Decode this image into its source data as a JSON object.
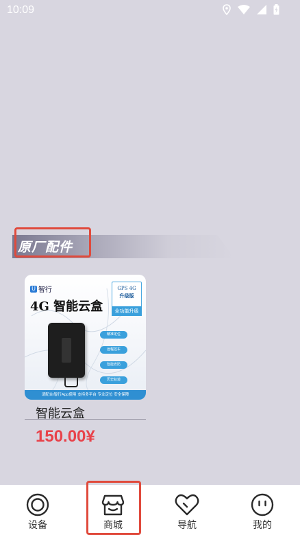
{
  "status_bar": {
    "time": "10:09",
    "icons": [
      "location-icon",
      "wifi-icon",
      "signal-icon",
      "battery-icon"
    ]
  },
  "section": {
    "title": "原厂配件"
  },
  "product": {
    "brand": "智行",
    "brand_mark": "U",
    "headline": "4G 智能云盒",
    "badge": {
      "line1": "GPS 4G",
      "line2": "升级版",
      "line3": "全功能升级"
    },
    "features": [
      "精准定位",
      "远程控车",
      "智能安防",
      "历史轨迹"
    ],
    "footer_text": "请配合i智行App使用 支持多平台 专业定位 安全保障",
    "name": "智能云盒",
    "price": "150.00¥"
  },
  "bottom_nav": {
    "items": [
      {
        "label": "设备",
        "icon": "target-icon"
      },
      {
        "label": "商城",
        "icon": "store-icon"
      },
      {
        "label": "导航",
        "icon": "heart-navigation-icon"
      },
      {
        "label": "我的",
        "icon": "face-icon"
      }
    ]
  },
  "colors": {
    "background": "#d8d6e0",
    "price": "#e8424a",
    "highlight": "#e04a3c",
    "accent_blue": "#3aa0dc"
  }
}
